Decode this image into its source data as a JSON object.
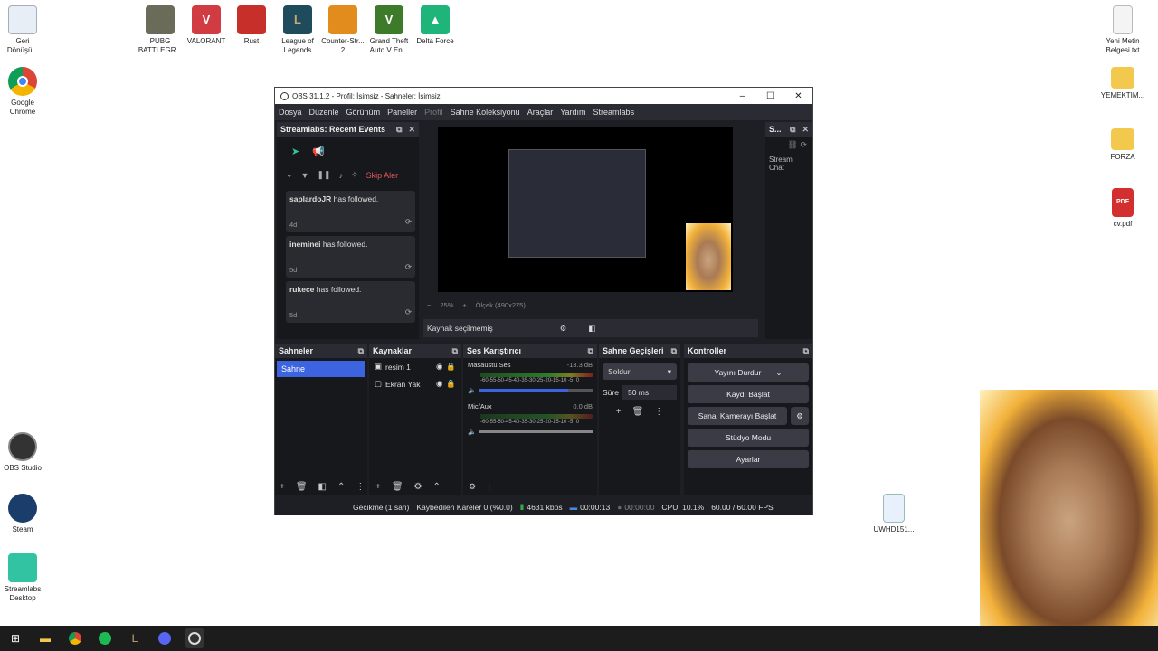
{
  "desktop": {
    "left_icons": [
      {
        "label": "Geri\nDönüşü...",
        "icon": "recycle-bin-icon"
      },
      {
        "label": "Google\nChrome",
        "icon": "chrome-icon"
      },
      {
        "label": "OBS Studio",
        "icon": "obs-icon"
      },
      {
        "label": "Steam",
        "icon": "steam-icon"
      },
      {
        "label": "Streamlabs\nDesktop",
        "icon": "streamlabs-icon"
      }
    ],
    "top_icons": [
      {
        "label": "PUBG\nBATTLEGR...",
        "color": "#6b6b5a"
      },
      {
        "label": "VALORANT",
        "color": "#d13b42"
      },
      {
        "label": "Rust",
        "color": "#c7302a"
      },
      {
        "label": "League of\nLegends",
        "color": "#1e4c5c"
      },
      {
        "label": "Counter-Str...\n2",
        "color": "#e28c1d"
      },
      {
        "label": "Grand Theft\nAuto V En...",
        "color": "#3d7a2a"
      },
      {
        "label": "Delta Force",
        "color": "#1fb57a"
      }
    ],
    "right_icons": [
      {
        "label": "Yeni Metin\nBelgesi.txt",
        "icon": "text-file-icon"
      },
      {
        "label": "YEMEKTIM...",
        "icon": "folder-icon"
      },
      {
        "label": "FORZA",
        "icon": "folder-icon"
      },
      {
        "label": "cv.pdf",
        "icon": "pdf-icon"
      },
      {
        "label": "UWHD151...",
        "icon": "image-file-icon"
      }
    ]
  },
  "obs": {
    "title": "OBS 31.1.2 - Profil: İsimsiz - Sahneler: İsimsiz",
    "menu": [
      "Dosya",
      "Düzenle",
      "Görünüm",
      "Paneller",
      "Profil",
      "Sahne Koleksiyonu",
      "Araçlar",
      "Yardım",
      "Streamlabs"
    ],
    "recent_events": {
      "title": "Streamlabs: Recent Events",
      "skip_label": "Skip Aler",
      "events": [
        {
          "user": "saplardoJR",
          "text": "has followed.",
          "time": "4d"
        },
        {
          "user": "ineminei",
          "text": "has followed.",
          "time": "5d"
        },
        {
          "user": "rukece",
          "text": "has followed.",
          "time": "5d"
        }
      ]
    },
    "chat_dock": {
      "title": "S...",
      "label": "Stream Chat"
    },
    "preview": {
      "zoom": "25%",
      "scale": "Ölçek (490x275)",
      "source_label": "Kaynak seçilmemiş"
    },
    "scenes": {
      "title": "Sahneler",
      "items": [
        "Sahne"
      ]
    },
    "sources": {
      "title": "Kaynaklar",
      "items": [
        "resim 1",
        "Ekran Yak"
      ]
    },
    "mixer": {
      "title": "Ses Karıştırıcı",
      "channels": [
        {
          "name": "Masaüstü Ses",
          "db": "-13.3 dB",
          "volume": 0.78
        },
        {
          "name": "Mic/Aux",
          "db": "0.0 dB",
          "volume": 1.0
        }
      ],
      "ticks": "-60-55-50-45-40-35-30-25-20-15-10 -5  0"
    },
    "transitions": {
      "title": "Sahne Geçişleri",
      "type": "Soldur",
      "duration_label": "Süre",
      "duration": "50 ms"
    },
    "controls": {
      "title": "Kontroller",
      "stream": "Yayını Durdur",
      "record": "Kaydı Başlat",
      "virtualcam": "Sanal Kamerayı Başlat",
      "studio": "Stüdyo Modu",
      "settings": "Ayarlar"
    },
    "status": {
      "delay": "Gecikme (1 san)",
      "dropped": "Kaybedilen Kareler 0 (%0.0)",
      "bitrate": "4631 kbps",
      "stream_time": "00:00:13",
      "rec_time": "00:00:00",
      "cpu": "CPU: 10.1%",
      "fps": "60.00 / 60.00 FPS"
    }
  }
}
